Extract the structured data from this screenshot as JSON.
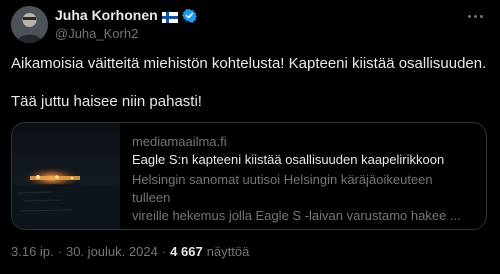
{
  "author": {
    "name": "Juha Korhonen",
    "handle": "@Juha_Korh2"
  },
  "icons": {
    "flag": "finland-flag-icon",
    "verified": "verified-badge-icon",
    "more": "more-options-icon"
  },
  "tweet": {
    "line1": "Aikamoisia väitteitä miehistön kohtelusta! Kapteeni kiistää osallisuuden.",
    "line2": "Tää juttu haisee niin pahasti!"
  },
  "card": {
    "domain": "mediamaailma.fi",
    "title": "Eagle S:n kapteeni kiistää osallisuuden kaapelirikkoon",
    "description_line1": "Helsingin sanomat uutisoi Helsingin käräjäoikeuteen tulleen",
    "description_line2": "vireille hekemus jolla Eagle S -laivan varustamo hakee ..."
  },
  "meta": {
    "time": "3.16 ip.",
    "separator": "·",
    "date": "30. jouluk. 2024",
    "separator2": "·",
    "views_count": "4 667",
    "views_label": "näyttöä"
  },
  "colors": {
    "background": "#000000",
    "text": "#e7e9ea",
    "secondary": "#71767b",
    "verified": "#1d9bf0",
    "border": "#2f3336"
  }
}
